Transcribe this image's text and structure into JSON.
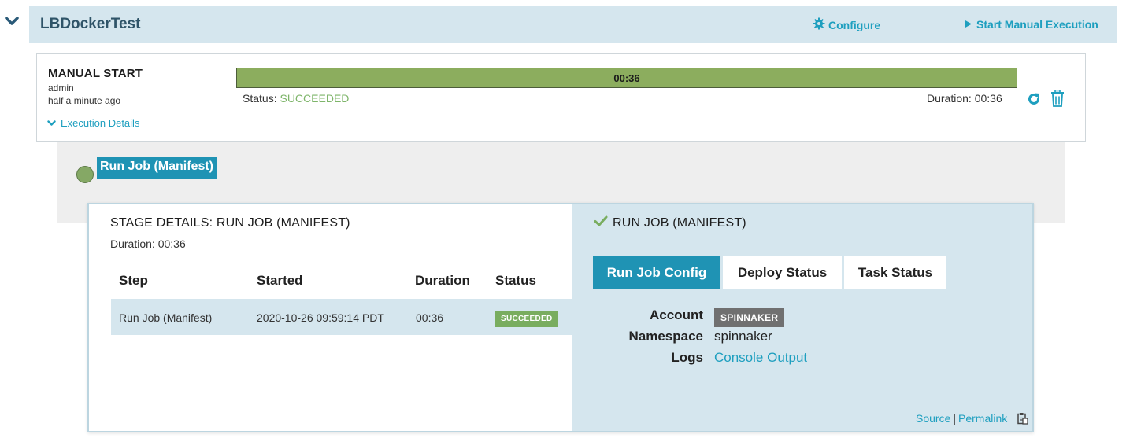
{
  "pipeline": {
    "name": "LBDockerTest",
    "configure_label": "Configure",
    "start_manual_label": "Start Manual Execution"
  },
  "execution": {
    "trigger_title": "MANUAL START",
    "user": "admin",
    "time_ago": "half a minute ago",
    "details_toggle_label": "Execution Details",
    "progress_label": "00:36",
    "status_prefix": "Status:",
    "status_value": "SUCCEEDED",
    "duration_text": "Duration: 00:36"
  },
  "graph": {
    "stage_label": "Run Job (Manifest)"
  },
  "stage_details": {
    "title": "STAGE DETAILS: RUN JOB (MANIFEST)",
    "duration_text": "Duration: 00:36",
    "columns": [
      "Step",
      "Started",
      "Duration",
      "Status"
    ],
    "rows": [
      {
        "step": "Run Job (Manifest)",
        "started": "2020-10-26 09:59:14 PDT",
        "duration": "00:36",
        "status": "SUCCEEDED"
      }
    ]
  },
  "job_panel": {
    "title": "RUN JOB (MANIFEST)",
    "tabs": [
      "Run Job Config",
      "Deploy Status",
      "Task Status"
    ],
    "active_tab": "Run Job Config",
    "account_label": "Account",
    "account_value": "SPINNAKER",
    "namespace_label": "Namespace",
    "namespace_value": "spinnaker",
    "logs_label": "Logs",
    "logs_link": "Console Output",
    "footer_source": "Source",
    "footer_separator": "|",
    "footer_permalink": "Permalink"
  },
  "icons": {
    "collapse": "chevron-down-icon",
    "configure": "gear-icon",
    "start": "play-icon",
    "details": "chevron-down-icon",
    "rerun": "refresh-icon",
    "delete": "trash-icon",
    "succeeded": "check-icon",
    "clipboard": "clipboard-icon"
  },
  "colors": {
    "accent": "#1f93b4",
    "link": "#1e9fbf",
    "success": "#79ad5f",
    "progress_fill": "#8cad5e",
    "header_bg": "#d5e6ee"
  }
}
